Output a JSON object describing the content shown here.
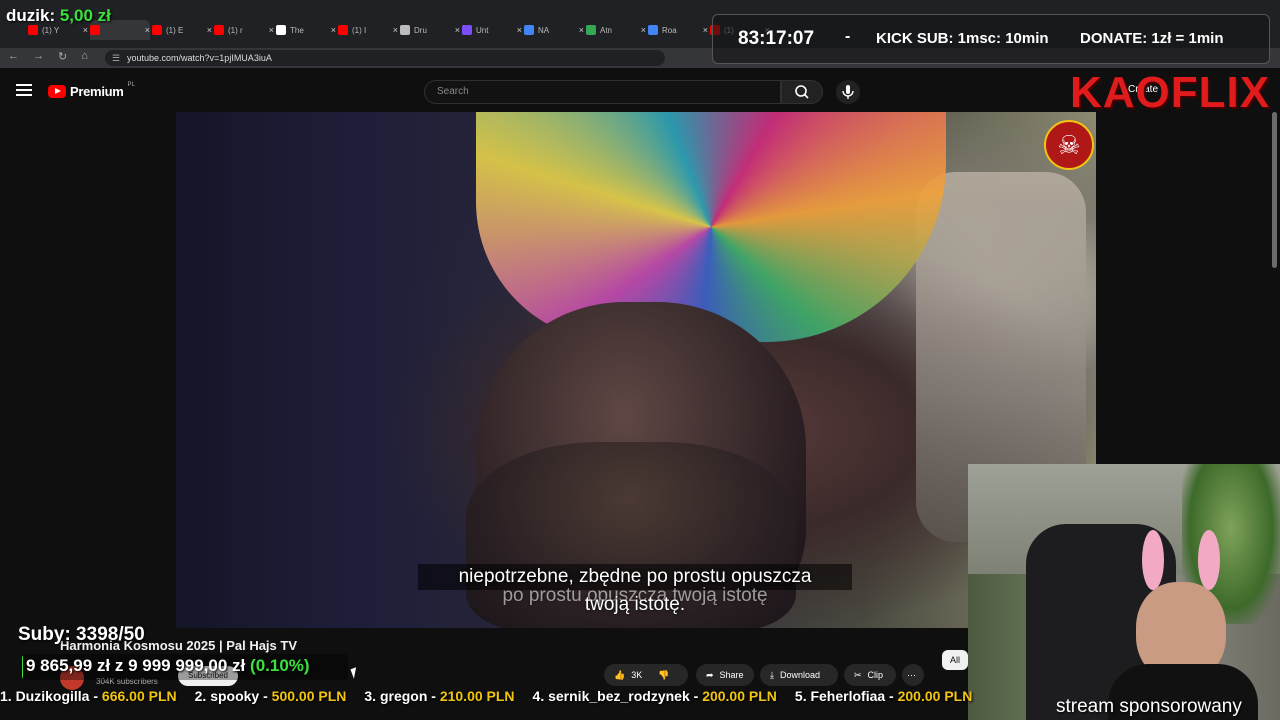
{
  "browser": {
    "tabs": [
      {
        "label": "(1) Y",
        "color": "#ff0000"
      },
      {
        "label": "",
        "color": "#ff0000",
        "active": true
      },
      {
        "label": "(1) E",
        "color": "#ff0000"
      },
      {
        "label": "(1) r",
        "color": "#ff0000"
      },
      {
        "label": "The",
        "color": "#ffffff"
      },
      {
        "label": "(1) I",
        "color": "#ff0000"
      },
      {
        "label": "Dru",
        "color": "#bbbbbb"
      },
      {
        "label": "Unt",
        "color": "#7c4dff"
      },
      {
        "label": "NA",
        "color": "#4285f4"
      },
      {
        "label": "Atn",
        "color": "#34a853"
      },
      {
        "label": "Roa",
        "color": "#4285f4"
      },
      {
        "label": "(1)",
        "color": "#ff0000"
      }
    ],
    "url": "youtube.com/watch?v=1pjIMUA3iuA"
  },
  "overlay": {
    "donor_name": "duzik:",
    "donor_amount": "5,00 zł",
    "timer": "83:17:07",
    "dash": "-",
    "kick_sub": "KICK SUB: 1msc: 10min",
    "donate_rate": "DONATE: 1zł = 1min",
    "brand": "KAOFLIX",
    "subs_count": "Suby: 3398/50",
    "goal_text": "9 865,99 zł",
    "goal_sep": " z ",
    "goal_target": "9 999 999,00 zł",
    "goal_pct": "(0.10%)",
    "goal_fraction": 0.001,
    "stream_label": "stream sponsorowany",
    "ticker": [
      {
        "rank": "1. Duzikogilla - ",
        "amount": "666.00 PLN"
      },
      {
        "rank": "2. spooky - ",
        "amount": "500.00 PLN"
      },
      {
        "rank": "3. gregon - ",
        "amount": "210.00 PLN"
      },
      {
        "rank": "4. sernik_bez_rodzynek - ",
        "amount": "200.00 PLN"
      },
      {
        "rank": "5. Feherlofiaa - ",
        "amount": "200.00 PLN"
      }
    ]
  },
  "youtube": {
    "premium_label": "Premium",
    "region": "PL",
    "search_placeholder": "Search",
    "create_label": "Create",
    "video_title": "Harmonia Kosmosu 2025 | Pal Hajs TV",
    "subscribers": "304K subscribers",
    "subscribe_label": "Subscribed",
    "likes": "3K",
    "share_label": "Share",
    "download_label": "Download",
    "clip_label": "Clip",
    "all_chip": "All",
    "captions": {
      "line1": "niepotrzebne, zbędne po prostu opuszcza",
      "line2": "po prostu opuszcza twoją istotę",
      "line3": "twoją istotę."
    }
  }
}
